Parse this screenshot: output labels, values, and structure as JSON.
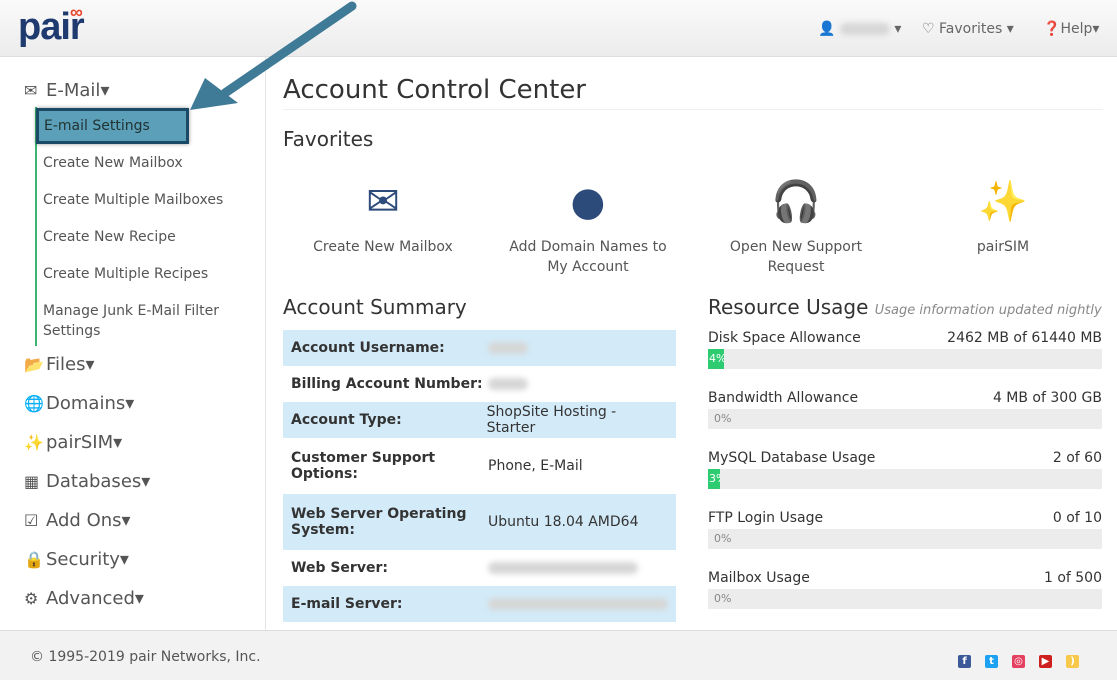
{
  "header": {
    "logo": "pair",
    "favorites": "Favorites",
    "help": "Help"
  },
  "sidebar": {
    "sections": [
      {
        "label": "E-Mail",
        "icon": "envelope-icon"
      },
      {
        "label": "Files",
        "icon": "folder-icon"
      },
      {
        "label": "Domains",
        "icon": "globe-icon"
      },
      {
        "label": "pairSIM",
        "icon": "magic-wand-icon"
      },
      {
        "label": "Databases",
        "icon": "grid-icon"
      },
      {
        "label": "Add Ons",
        "icon": "checkbox-icon"
      },
      {
        "label": "Security",
        "icon": "lock-icon"
      },
      {
        "label": "Advanced",
        "icon": "gears-icon"
      }
    ],
    "email_items": [
      "E-mail Settings",
      "Create New Mailbox",
      "Create Multiple Mailboxes",
      "Create New Recipe",
      "Create Multiple Recipes",
      "Manage Junk E-Mail Filter Settings"
    ]
  },
  "main": {
    "title": "Account Control Center",
    "favorites_title": "Favorites",
    "favorites": [
      {
        "label": "Create New Mailbox",
        "icon": "envelope-plus-icon"
      },
      {
        "label": "Add Domain Names to My Account",
        "icon": "globe-icon"
      },
      {
        "label": "Open New Support Request",
        "icon": "headset-icon"
      },
      {
        "label": "pairSIM",
        "icon": "magic-wand-icon"
      }
    ],
    "summary_title": "Account Summary",
    "summary": [
      {
        "k": "Account Username:",
        "v": ""
      },
      {
        "k": "Billing Account Number:",
        "v": ""
      },
      {
        "k": "Account Type:",
        "v": "ShopSite Hosting - Starter"
      },
      {
        "k": "Customer Support Options:",
        "v": "Phone, E-Mail"
      },
      {
        "k": "Web Server Operating System:",
        "v": "Ubuntu 18.04 AMD64"
      },
      {
        "k": "Web Server:",
        "v": ""
      },
      {
        "k": "E-mail Server:",
        "v": ""
      }
    ],
    "resource_title": "Resource Usage",
    "resource_note": "Usage information updated nightly",
    "resources": [
      {
        "label": "Disk Space Allowance",
        "value": "2462 MB of 61440 MB",
        "percent": 4,
        "pct_label": "4%"
      },
      {
        "label": "Bandwidth Allowance",
        "value": "4 MB of 300 GB",
        "percent": 0,
        "pct_label": "0%"
      },
      {
        "label": "MySQL Database Usage",
        "value": "2 of 60",
        "percent": 3,
        "pct_label": "3%"
      },
      {
        "label": "FTP Login Usage",
        "value": "0 of 10",
        "percent": 0,
        "pct_label": "0%"
      },
      {
        "label": "Mailbox Usage",
        "value": "1 of 500",
        "percent": 0,
        "pct_label": "0%"
      }
    ]
  },
  "footer": {
    "copyright": "© 1995-2019 pair Networks, Inc.",
    "social": [
      {
        "icon": "facebook-icon",
        "color": "#3b5998"
      },
      {
        "icon": "twitter-icon",
        "color": "#1da1f2"
      },
      {
        "icon": "instagram-icon",
        "color": "#e4405f"
      },
      {
        "icon": "youtube-icon",
        "color": "#cd201f"
      },
      {
        "icon": "rss-icon",
        "color": "#f8c84a"
      }
    ]
  },
  "colors": {
    "accent": "#2c4a7a",
    "highlight": "#5b9fb8",
    "progress": "#2ecc71",
    "row_alt": "#d3ebf8"
  }
}
